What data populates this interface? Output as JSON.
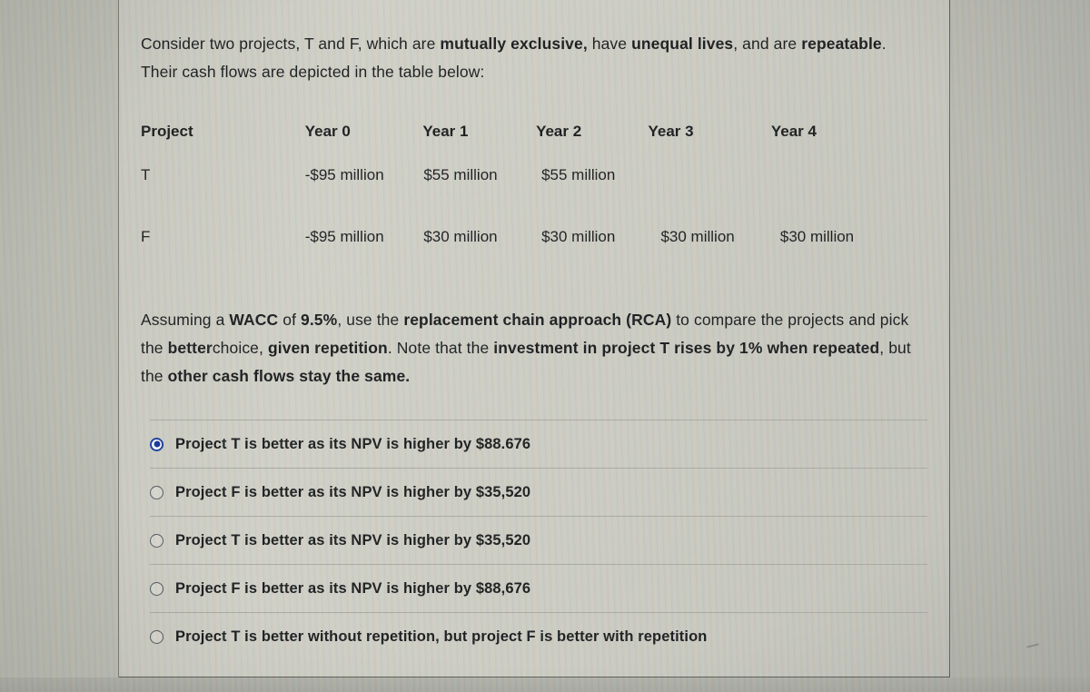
{
  "question": {
    "intro_parts": [
      {
        "text": "Consider two projects, T and F, which are ",
        "bold": false
      },
      {
        "text": "mutually exclusive,",
        "bold": true
      },
      {
        "text": " have ",
        "bold": false
      },
      {
        "text": "unequal lives",
        "bold": true
      },
      {
        "text": ", and are ",
        "bold": false
      },
      {
        "text": "repeatable",
        "bold": true
      },
      {
        "text": ". Their cash flows are depicted in the table below:",
        "bold": false
      }
    ],
    "instruction_parts": [
      {
        "text": "Assuming a ",
        "bold": false
      },
      {
        "text": "WACC",
        "bold": true
      },
      {
        "text": " of ",
        "bold": false
      },
      {
        "text": "9.5%",
        "bold": true
      },
      {
        "text": ", use the ",
        "bold": false
      },
      {
        "text": "replacement chain approach (RCA)",
        "bold": true
      },
      {
        "text": " to compare the projects and pick the ",
        "bold": false
      },
      {
        "text": "better",
        "bold": true
      },
      {
        "text": "choice, ",
        "bold": false
      },
      {
        "text": "given repetition",
        "bold": true
      },
      {
        "text": ". Note that the ",
        "bold": false
      },
      {
        "text": "investment in project T rises by 1% when repeated",
        "bold": true
      },
      {
        "text": ", but the ",
        "bold": false
      },
      {
        "text": "other cash flows stay the same.",
        "bold": true
      }
    ]
  },
  "table": {
    "headers": [
      "Project",
      "Year 0",
      "Year 1",
      "Year 2",
      "Year 3",
      "Year 4"
    ],
    "rows": [
      {
        "project": "T",
        "cells": [
          "-$95 million",
          "$55 million",
          "$55 million",
          "",
          ""
        ]
      },
      {
        "project": "F",
        "cells": [
          "-$95 million",
          "$30 million",
          "$30 million",
          "$30 million",
          "$30 million"
        ]
      }
    ]
  },
  "options": [
    {
      "label": "Project T is better as its NPV is higher by $88.676",
      "selected": true
    },
    {
      "label": "Project F is better as its NPV is higher by $35,520",
      "selected": false
    },
    {
      "label": "Project T is better as its NPV is higher by $35,520",
      "selected": false
    },
    {
      "label": "Project F is better as its NPV is higher by $88,676",
      "selected": false
    },
    {
      "label": "Project T is better without repetition, but project F is better with repetition",
      "selected": false
    }
  ],
  "colors": {
    "panel_background": "#cbccc2",
    "outer_background": "#b9bab2",
    "text": "#1b1c1e",
    "selected_radio": "#16379a",
    "radio_outline": "#54565a",
    "separator": "#a9aaa2",
    "panel_border": "#5d5e58"
  }
}
